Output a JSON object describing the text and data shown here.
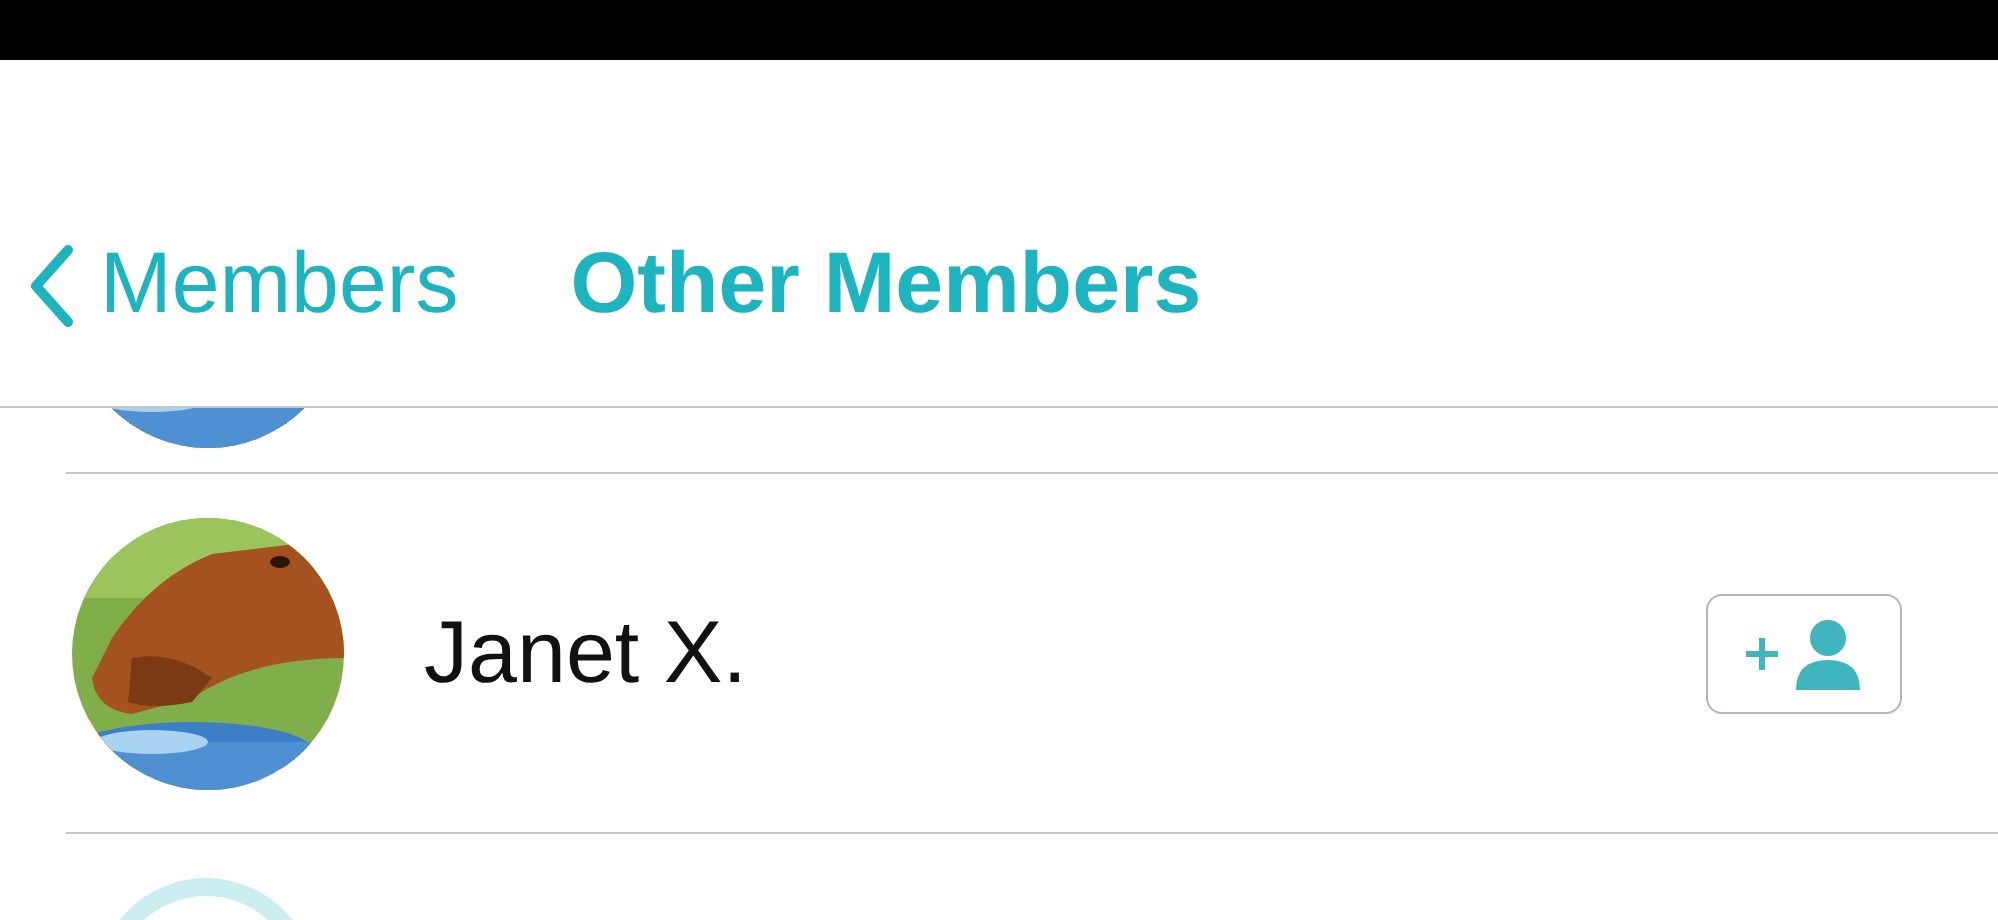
{
  "nav": {
    "back_label": "Members",
    "title": "Other Members"
  },
  "members": [
    {
      "kind": "picture"
    },
    {
      "kind": "picture",
      "name": "Janet X.",
      "can_add": true
    },
    {
      "kind": "placeholder"
    }
  ]
}
